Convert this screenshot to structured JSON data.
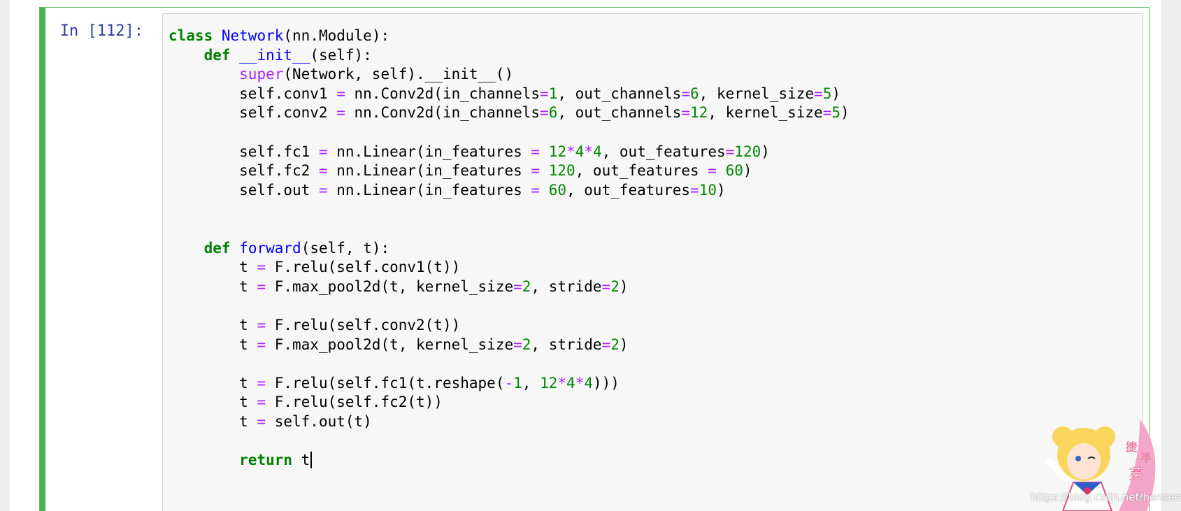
{
  "cell": {
    "prompt": "In [112]:",
    "lines": [
      [
        [
          "kw",
          "class"
        ],
        [
          "name",
          " "
        ],
        [
          "def",
          "Network"
        ],
        [
          "punc",
          "(nn.Module):"
        ]
      ],
      [
        [
          "name",
          "    "
        ],
        [
          "kw",
          "def"
        ],
        [
          "name",
          " "
        ],
        [
          "def",
          "__init__"
        ],
        [
          "punc",
          "(self):"
        ]
      ],
      [
        [
          "name",
          "        "
        ],
        [
          "builtin",
          "super"
        ],
        [
          "punc",
          "(Network, self).__init__()"
        ]
      ],
      [
        [
          "name",
          "        self.conv1 "
        ],
        [
          "op",
          "="
        ],
        [
          "name",
          " nn.Conv2d(in_channels"
        ],
        [
          "op",
          "="
        ],
        [
          "num",
          "1"
        ],
        [
          "punc",
          ", out_channels"
        ],
        [
          "op",
          "="
        ],
        [
          "num",
          "6"
        ],
        [
          "punc",
          ", kernel_size"
        ],
        [
          "op",
          "="
        ],
        [
          "num",
          "5"
        ],
        [
          "punc",
          ")"
        ]
      ],
      [
        [
          "name",
          "        self.conv2 "
        ],
        [
          "op",
          "="
        ],
        [
          "name",
          " nn.Conv2d(in_channels"
        ],
        [
          "op",
          "="
        ],
        [
          "num",
          "6"
        ],
        [
          "punc",
          ", out_channels"
        ],
        [
          "op",
          "="
        ],
        [
          "num",
          "12"
        ],
        [
          "punc",
          ", kernel_size"
        ],
        [
          "op",
          "="
        ],
        [
          "num",
          "5"
        ],
        [
          "punc",
          ")"
        ]
      ],
      [],
      [
        [
          "name",
          "        self.fc1 "
        ],
        [
          "op",
          "="
        ],
        [
          "name",
          " nn.Linear(in_features "
        ],
        [
          "op",
          "="
        ],
        [
          "name",
          " "
        ],
        [
          "num",
          "12"
        ],
        [
          "op",
          "*"
        ],
        [
          "num",
          "4"
        ],
        [
          "op",
          "*"
        ],
        [
          "num",
          "4"
        ],
        [
          "punc",
          ", out_features"
        ],
        [
          "op",
          "="
        ],
        [
          "num",
          "120"
        ],
        [
          "punc",
          ")"
        ]
      ],
      [
        [
          "name",
          "        self.fc2 "
        ],
        [
          "op",
          "="
        ],
        [
          "name",
          " nn.Linear(in_features "
        ],
        [
          "op",
          "="
        ],
        [
          "name",
          " "
        ],
        [
          "num",
          "120"
        ],
        [
          "punc",
          ", out_features "
        ],
        [
          "op",
          "="
        ],
        [
          "name",
          " "
        ],
        [
          "num",
          "60"
        ],
        [
          "punc",
          ")"
        ]
      ],
      [
        [
          "name",
          "        self.out "
        ],
        [
          "op",
          "="
        ],
        [
          "name",
          " nn.Linear(in_features "
        ],
        [
          "op",
          "="
        ],
        [
          "name",
          " "
        ],
        [
          "num",
          "60"
        ],
        [
          "punc",
          ", out_features"
        ],
        [
          "op",
          "="
        ],
        [
          "num",
          "10"
        ],
        [
          "punc",
          ")"
        ]
      ],
      [],
      [],
      [
        [
          "name",
          "    "
        ],
        [
          "kw",
          "def"
        ],
        [
          "name",
          " "
        ],
        [
          "def",
          "forward"
        ],
        [
          "punc",
          "(self, t):"
        ]
      ],
      [
        [
          "name",
          "        t "
        ],
        [
          "op",
          "="
        ],
        [
          "name",
          " F.relu(self.conv1(t))"
        ]
      ],
      [
        [
          "name",
          "        t "
        ],
        [
          "op",
          "="
        ],
        [
          "name",
          " F.max_pool2d(t, kernel_size"
        ],
        [
          "op",
          "="
        ],
        [
          "num",
          "2"
        ],
        [
          "punc",
          ", stride"
        ],
        [
          "op",
          "="
        ],
        [
          "num",
          "2"
        ],
        [
          "punc",
          ")"
        ]
      ],
      [],
      [
        [
          "name",
          "        t "
        ],
        [
          "op",
          "="
        ],
        [
          "name",
          " F.relu(self.conv2(t))"
        ]
      ],
      [
        [
          "name",
          "        t "
        ],
        [
          "op",
          "="
        ],
        [
          "name",
          " F.max_pool2d(t, kernel_size"
        ],
        [
          "op",
          "="
        ],
        [
          "num",
          "2"
        ],
        [
          "punc",
          ", stride"
        ],
        [
          "op",
          "="
        ],
        [
          "num",
          "2"
        ],
        [
          "punc",
          ")"
        ]
      ],
      [],
      [
        [
          "name",
          "        t "
        ],
        [
          "op",
          "="
        ],
        [
          "name",
          " F.relu(self.fc1(t.reshape("
        ],
        [
          "op",
          "-"
        ],
        [
          "num",
          "1"
        ],
        [
          "punc",
          ", "
        ],
        [
          "num",
          "12"
        ],
        [
          "op",
          "*"
        ],
        [
          "num",
          "4"
        ],
        [
          "op",
          "*"
        ],
        [
          "num",
          "4"
        ],
        [
          "punc",
          ")))"
        ]
      ],
      [
        [
          "name",
          "        t "
        ],
        [
          "op",
          "="
        ],
        [
          "name",
          " F.relu(self.fc2(t))"
        ]
      ],
      [
        [
          "name",
          "        t "
        ],
        [
          "op",
          "="
        ],
        [
          "name",
          " self.out(t)"
        ]
      ],
      [],
      [
        [
          "name",
          "        "
        ],
        [
          "kw",
          "return"
        ],
        [
          "name",
          " t"
        ]
      ]
    ]
  },
  "overlay": {
    "watermark": "https://blog.csdn.net/hensere",
    "mascot_chars": [
      "捷",
      "半",
      "英"
    ]
  },
  "colors": {
    "cell_border": "#66bb6a",
    "cell_bar": "#4caf50",
    "prompt": "#303f9f",
    "keyword": "#008000",
    "definition": "#0000ff",
    "operator": "#aa22ff",
    "number": "#008800",
    "editor_bg": "#f7f7f7"
  }
}
